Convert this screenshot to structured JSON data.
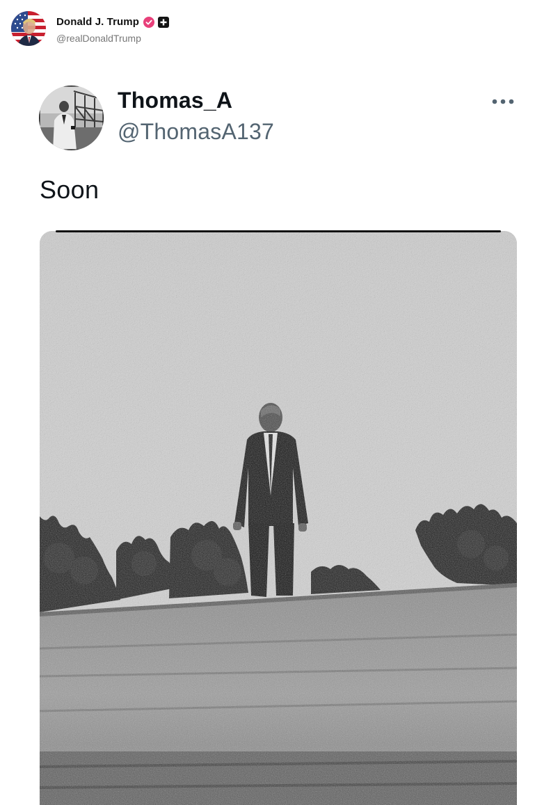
{
  "outer_post": {
    "author_name": "Donald J. Trump",
    "handle": "@realDonaldTrump",
    "verified_icon": "verified-check-icon",
    "verified_color": "#e8407a",
    "badge_icon": "truth-social-badge-icon",
    "avatar_icon": "american-flag-avatar"
  },
  "embedded_post": {
    "author_name": "Thomas_A",
    "handle": "@ThomasA137",
    "text": "Soon",
    "more_icon": "more-options-icon",
    "avatar_icon": "man-portrait-avatar",
    "media": {
      "type": "black-and-white photograph",
      "subject": "man in dark suit standing on a rooftop"
    }
  }
}
